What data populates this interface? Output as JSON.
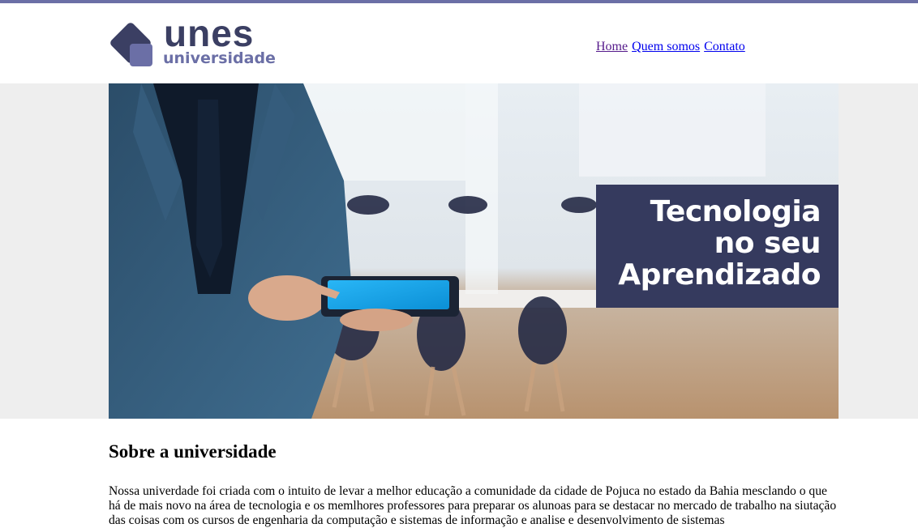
{
  "brand": {
    "name": "unes",
    "subtitle": "universidade",
    "colors": {
      "primary": "#3b3f63",
      "accent": "#6b6fa6"
    }
  },
  "nav": {
    "items": [
      {
        "label": "Home"
      },
      {
        "label": "Quem somos"
      },
      {
        "label": "Contato"
      }
    ]
  },
  "hero": {
    "caption": [
      "Tecnologia",
      "no seu",
      "Aprendizado"
    ]
  },
  "about": {
    "title": "Sobre a universidade",
    "text": "Nossa univerdade foi criada com o intuito de levar a melhor educação a comunidade da cidade de Pojuca no estado da Bahia mesclando o que há de mais novo na área de tecnologia e os memlhores professores para preparar os alunoas para se destacar no mercado de trabalho na siutação das coisas com os cursos de engenharia da computação e sistemas de informação e analise e desenvolvimento de sistemas"
  }
}
